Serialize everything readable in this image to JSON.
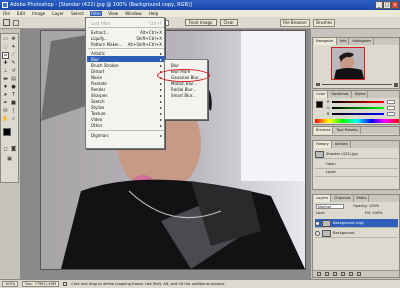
{
  "app": {
    "title": "Adobe Photoshop - [Standar (422).jpg @ 100% (Background copy, RGB)]"
  },
  "window_buttons": {
    "minimize": "_",
    "maximize": "□",
    "close": "x"
  },
  "menubar": [
    "File",
    "Edit",
    "Image",
    "Layer",
    "Select",
    "Filter",
    "View",
    "Window",
    "Help"
  ],
  "options": {
    "height_label": "Height:",
    "front_image_label": "Front Image",
    "clear_label": "Clear"
  },
  "palette_well": {
    "file_browser": "File Browser",
    "brushes": "Brushes"
  },
  "filter_menu": {
    "items": [
      {
        "label": "Last Filter",
        "shortcut": "Ctrl+F",
        "state": "dim"
      },
      {
        "label": "Extract...",
        "shortcut": "Alt+Ctrl+X"
      },
      {
        "label": "Liquify...",
        "shortcut": "Shift+Ctrl+X"
      },
      {
        "label": "Pattern Maker...",
        "shortcut": "Alt+Shift+Ctrl+X"
      },
      {
        "label": "Artistic",
        "arrow": "▸"
      },
      {
        "label": "Blur",
        "arrow": "▸",
        "state": "highlight"
      },
      {
        "label": "Brush Strokes",
        "arrow": "▸"
      },
      {
        "label": "Distort",
        "arrow": "▸"
      },
      {
        "label": "Noise",
        "arrow": "▸"
      },
      {
        "label": "Pixelate",
        "arrow": "▸"
      },
      {
        "label": "Render",
        "arrow": "▸"
      },
      {
        "label": "Sharpen",
        "arrow": "▸"
      },
      {
        "label": "Sketch",
        "arrow": "▸"
      },
      {
        "label": "Stylize",
        "arrow": "▸"
      },
      {
        "label": "Texture",
        "arrow": "▸"
      },
      {
        "label": "Video",
        "arrow": "▸"
      },
      {
        "label": "Other",
        "arrow": "▸"
      },
      {
        "label": "Digimarc",
        "arrow": "▸"
      }
    ]
  },
  "blur_submenu": {
    "items": [
      "Blur",
      "Blur More",
      "Gaussian Blur...",
      "Motion Blur...",
      "Radial Blur...",
      "Smart Blur..."
    ]
  },
  "navigator": {
    "tabs": [
      "Navigator",
      "Info",
      "Histogram"
    ]
  },
  "color_panel": {
    "tabs": [
      "Color",
      "Swatches",
      "Styles"
    ],
    "rows": [
      "R",
      "G",
      "B"
    ]
  },
  "brush_panel": {
    "tabs": [
      "Brushes",
      "Tool Presets"
    ]
  },
  "history_panel": {
    "tabs": [
      "History",
      "Actions"
    ],
    "rows": [
      "Standar (422).jpg",
      "Open",
      "Layer"
    ]
  },
  "layers_panel": {
    "tabs": [
      "Layers",
      "Channels",
      "Paths"
    ],
    "blend_mode": "Normal",
    "opacity": "Opacity: 100%",
    "lock_label": "Lock:",
    "fill": "Fill: 100%",
    "layers": [
      {
        "name": "Background copy",
        "selected": true
      },
      {
        "name": "Background",
        "selected": false
      }
    ]
  },
  "status": {
    "zoom": "100%",
    "doc": "Doc: 779K/1.49M",
    "hint": "Click and drag to define cropping frame. Use Shift, Alt, and Ctrl for additional options."
  },
  "colors": {
    "highlight": "#2f5fb8",
    "annotation": "#d71d1d"
  }
}
